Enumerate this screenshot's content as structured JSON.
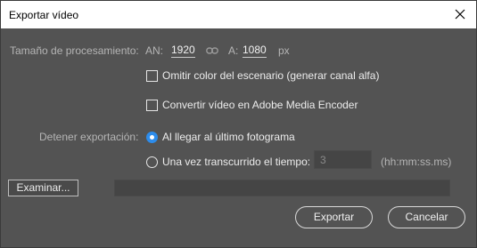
{
  "window": {
    "title": "Exportar vídeo"
  },
  "size": {
    "label": "Tamaño de procesamiento:",
    "width_label": "AN:",
    "width_value": "1920",
    "height_label": "A:",
    "height_value": "1080",
    "unit": "px"
  },
  "options": {
    "omit_stage_color": {
      "label": "Omitir color del escenario (generar canal alfa)",
      "checked": false
    },
    "convert_ame": {
      "label": "Convertir vídeo en Adobe Media Encoder",
      "checked": false
    }
  },
  "stop_export": {
    "label": "Detener exportación:",
    "option_last_frame": {
      "label": "Al llegar al último fotograma",
      "selected": true
    },
    "option_elapsed": {
      "label": "Una vez transcurrido el tiempo:",
      "selected": false
    },
    "time_value": "3",
    "time_format": "(hh:mm:ss.ms)"
  },
  "browse": {
    "label": "Examinar...",
    "path": ""
  },
  "buttons": {
    "export": "Exportar",
    "cancel": "Cancelar"
  },
  "colors": {
    "background": "#535353",
    "accent": "#2d8ceb",
    "titlebar": "#ffffff"
  },
  "icons": {
    "close": "close-icon",
    "link": "chain-link-icon"
  }
}
